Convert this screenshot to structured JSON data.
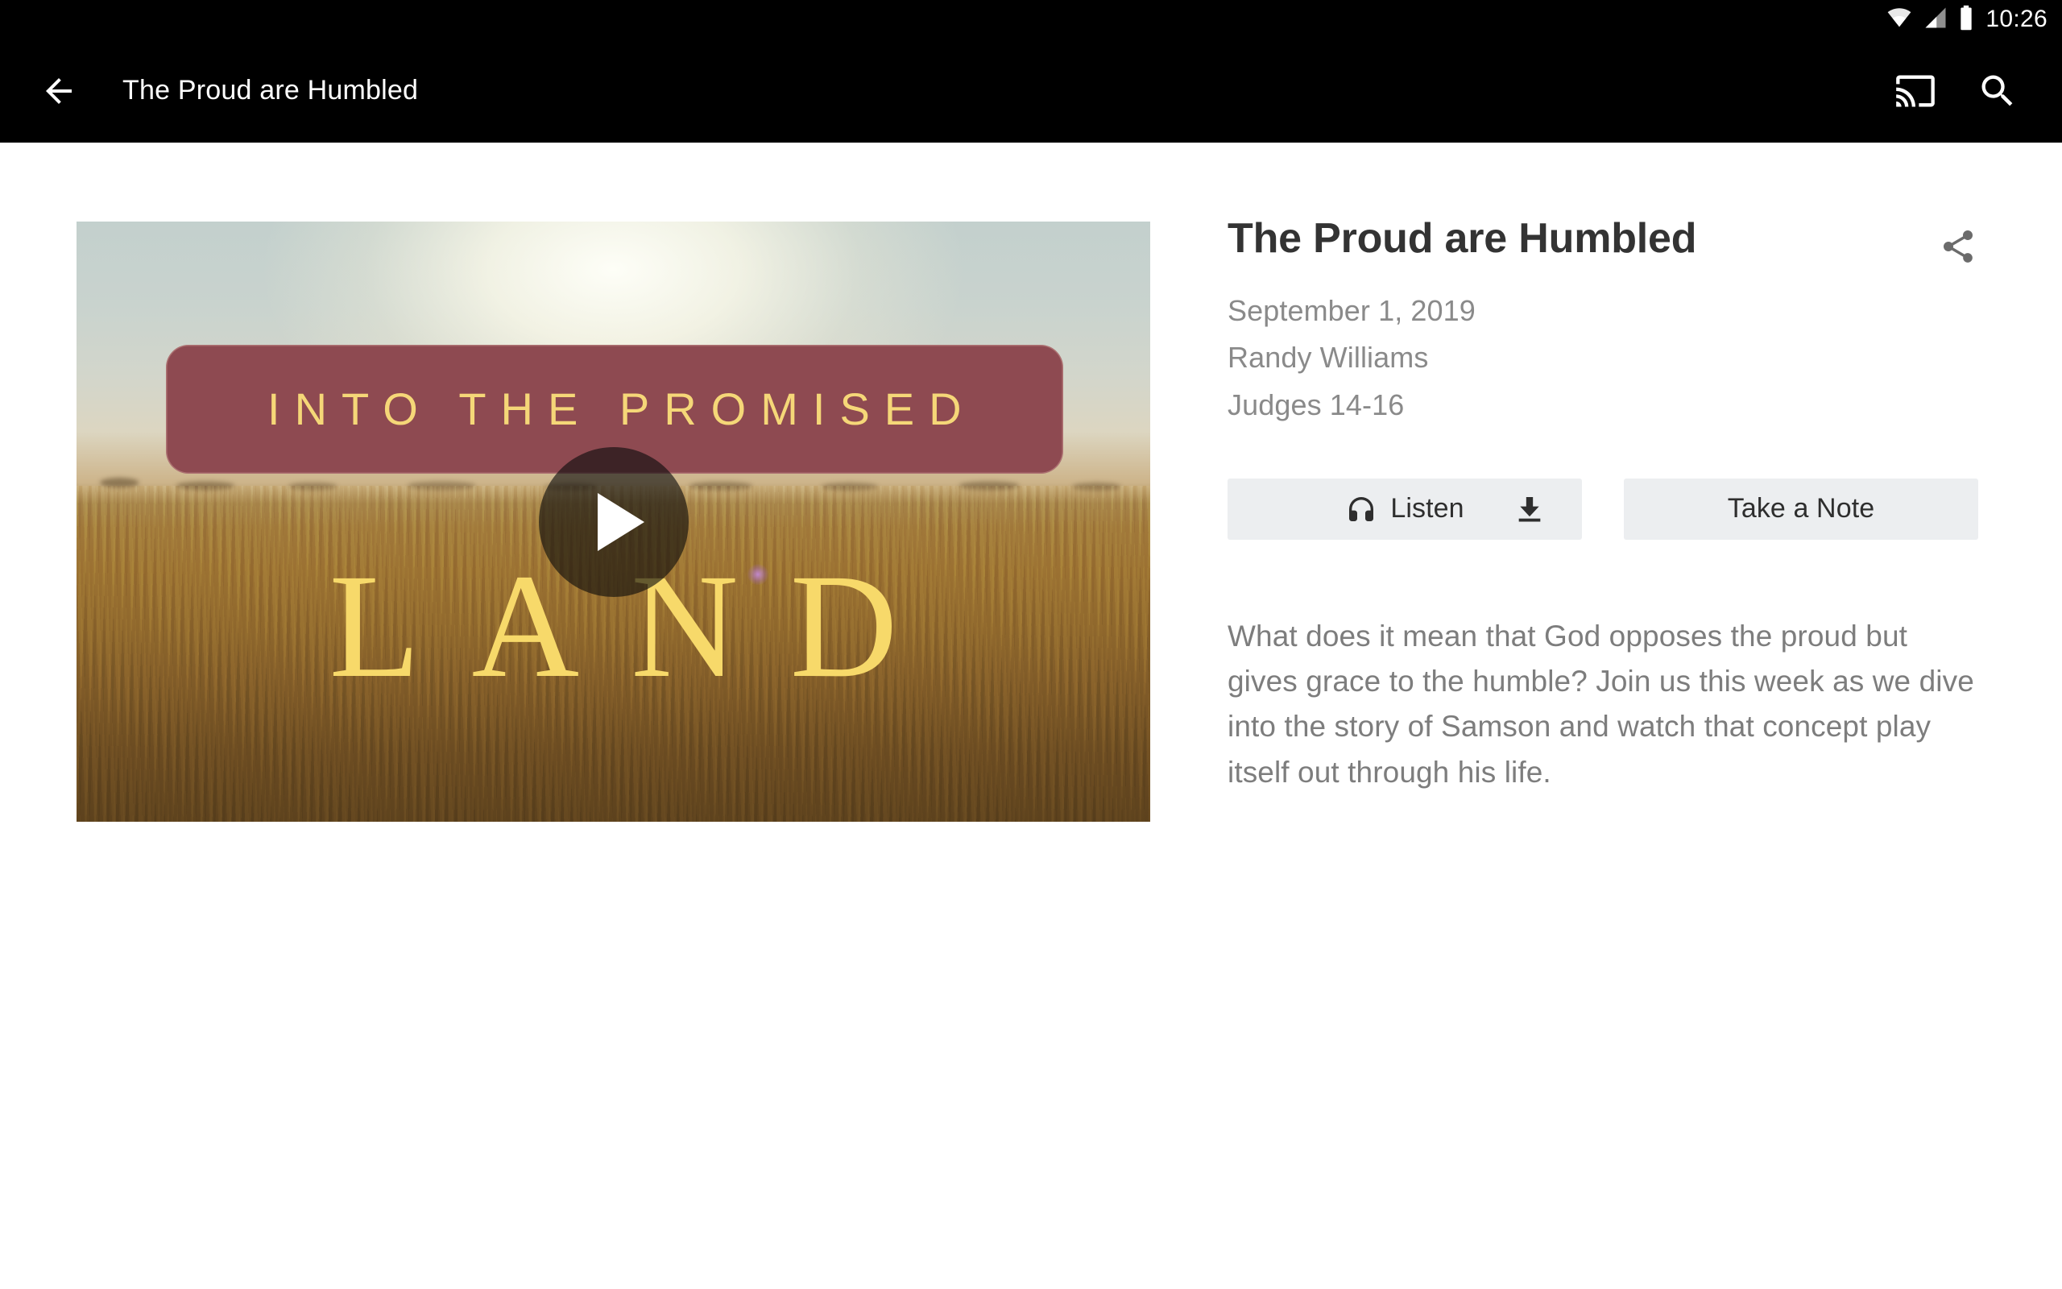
{
  "status_bar": {
    "time": "10:26",
    "icons": [
      "wifi-icon",
      "cell-signal-icon",
      "battery-icon"
    ]
  },
  "app_bar": {
    "back_icon": "back-arrow-icon",
    "title": "The Proud are Humbled",
    "actions": [
      {
        "icon": "cast-icon",
        "label": "Cast"
      },
      {
        "icon": "search-icon",
        "label": "Search"
      }
    ]
  },
  "video": {
    "series_title": "INTO THE PROMISED",
    "series_title_line2": "LAND",
    "play_icon": "play-icon",
    "alt": "Sermon series artwork: wheat field at sunset"
  },
  "details": {
    "title": "The Proud are Humbled",
    "date": "September 1, 2019",
    "speaker": "Randy Williams",
    "scripture": "Judges 14-16",
    "share_icon": "share-icon",
    "description": "What does it mean that God opposes the proud but gives grace to the humble? Join us this week as we dive into the story of Samson and watch that concept play itself out through his life."
  },
  "buttons": {
    "listen_label": "Listen",
    "listen_icon": "headphones-icon",
    "download_icon": "download-icon",
    "note_label": "Take a Note"
  },
  "colors": {
    "app_bar_bg": "#000000",
    "page_bg": "#ffffff",
    "title_text": "#333333",
    "meta_text": "#8a8a8a",
    "body_text": "#7d7d7d",
    "button_bg": "#eceef0",
    "banner_bg": "#8e4a51",
    "series_text": "#f5d778",
    "land_text": "#f7d96a"
  }
}
